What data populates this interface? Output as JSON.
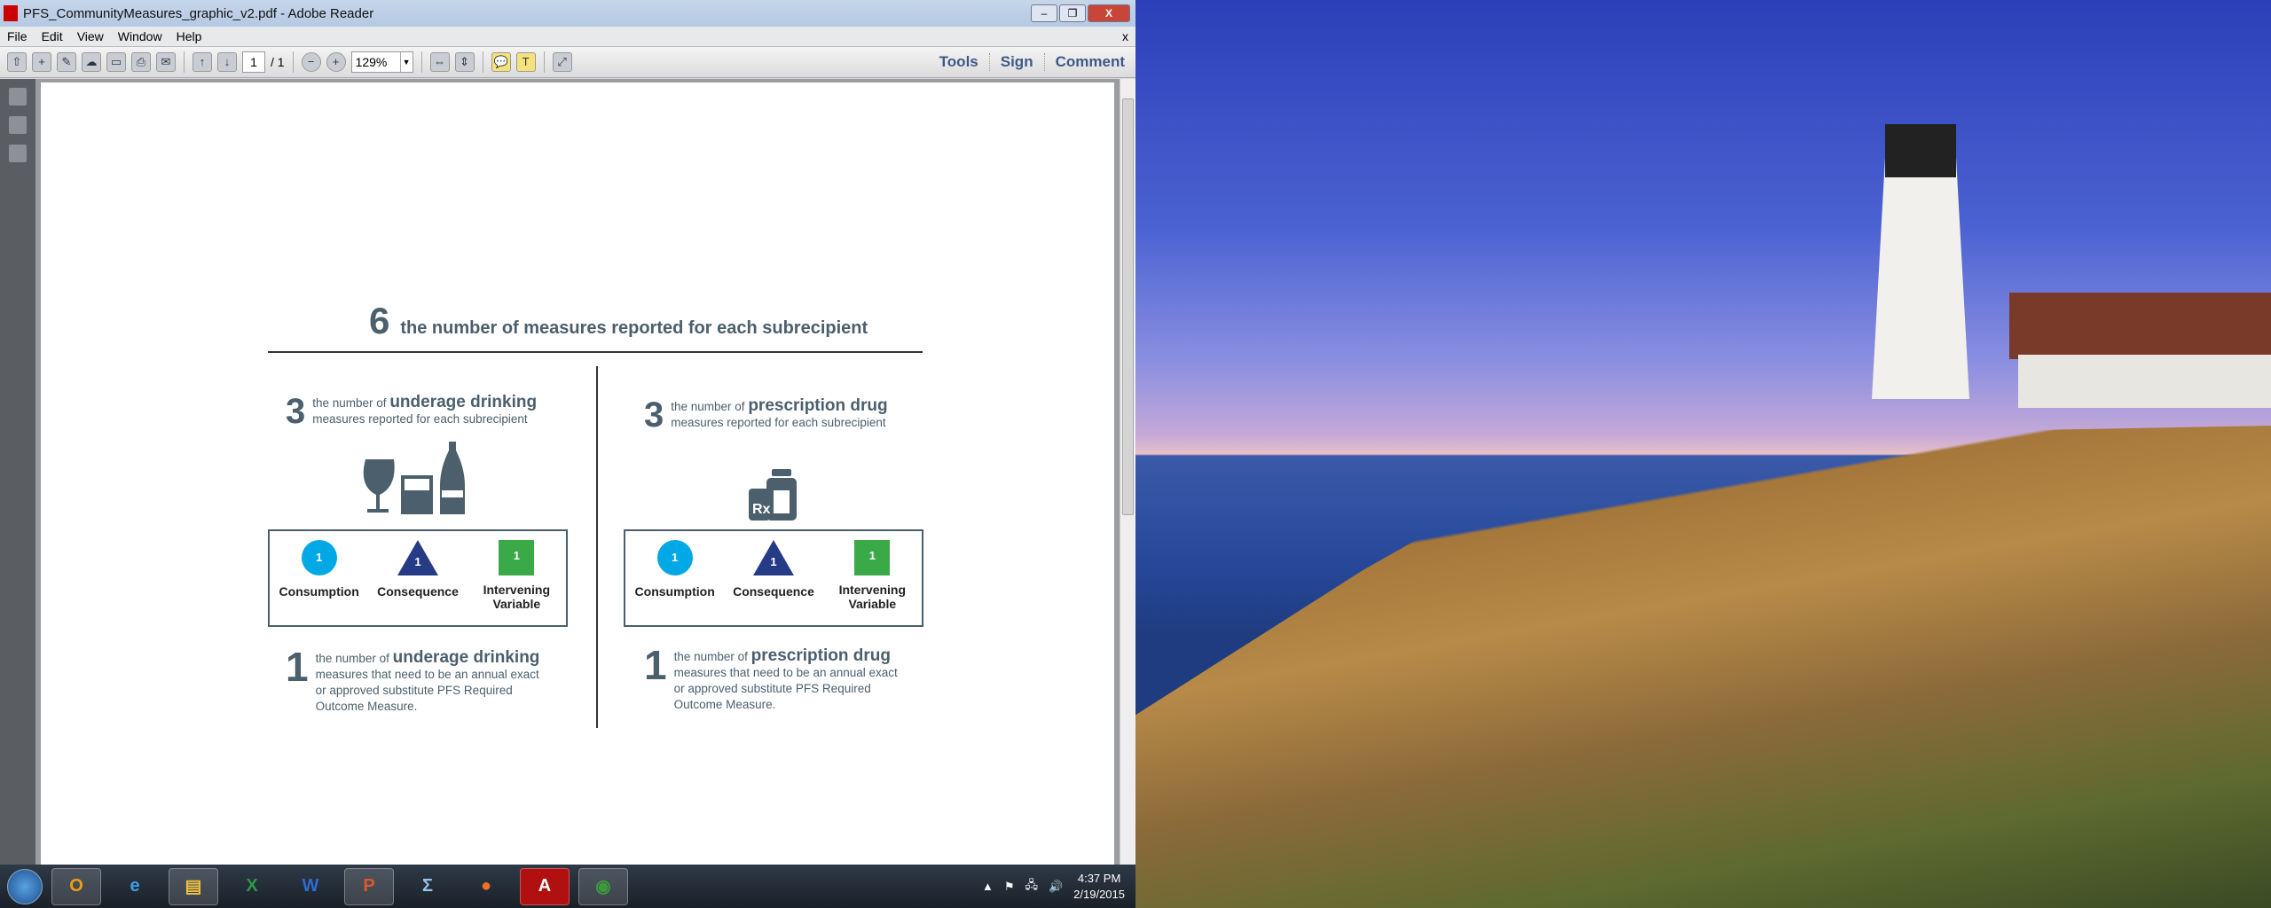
{
  "window": {
    "title": "PFS_CommunityMeasures_graphic_v2.pdf - Adobe Reader",
    "min": "–",
    "max": "❐",
    "close": "X"
  },
  "menu": [
    "File",
    "Edit",
    "View",
    "Window",
    "Help"
  ],
  "menu_close": "x",
  "toolbar": {
    "page_current": "1",
    "page_total": "/ 1",
    "zoom": "129%",
    "tools": "Tools",
    "sign": "Sign",
    "comment": "Comment"
  },
  "doc": {
    "total_number": "6",
    "total_text": "the number of measures reported for each subrecipient",
    "sections": [
      {
        "name": "underage drinking",
        "count": "3",
        "prefix": "the number of",
        "topic": "underage drinking",
        "suffix": "measures reported for each subrecipient",
        "measures": [
          {
            "value": "1",
            "label": "Consumption"
          },
          {
            "value": "1",
            "label": "Consequence"
          },
          {
            "value": "1",
            "label": "Intervening Variable"
          }
        ],
        "annual_count": "1",
        "annual_prefix": "the number of",
        "annual_topic": "underage drinking",
        "annual_text": "measures that need to be an annual exact or approved substitute PFS Required Outcome Measure."
      },
      {
        "name": "prescription drug",
        "count": "3",
        "prefix": "the number of",
        "topic": "prescription drug",
        "suffix": "measures reported for each subrecipient",
        "measures": [
          {
            "value": "1",
            "label": "Consumption"
          },
          {
            "value": "1",
            "label": "Consequence"
          },
          {
            "value": "1",
            "label": "Intervening Variable"
          }
        ],
        "annual_count": "1",
        "annual_prefix": "the number of",
        "annual_topic": "prescription drug",
        "annual_text": "measures that need to be an annual exact or approved substitute PFS Required Outcome Measure."
      }
    ]
  },
  "taskbar": {
    "apps": [
      "Outlook",
      "Internet Explorer",
      "Windows Explorer",
      "Excel",
      "Word",
      "PowerPoint",
      "Math",
      "Firefox",
      "Adobe Reader",
      "Chrome"
    ],
    "time": "4:37 PM",
    "date": "2/19/2015"
  },
  "colors": {
    "consumption": "#00a9e6",
    "consequence": "#253b86",
    "intervening": "#3aaa48",
    "text": "#4b5f6d"
  }
}
